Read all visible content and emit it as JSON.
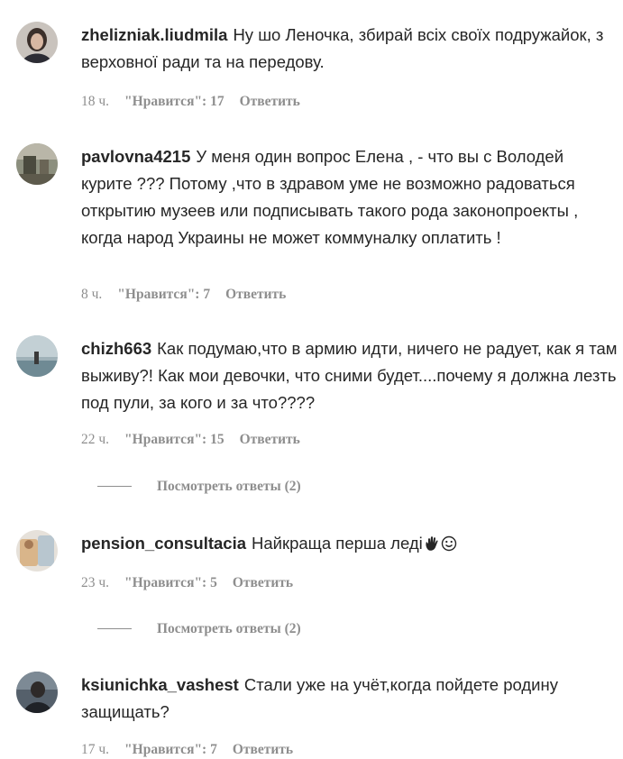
{
  "comments": [
    {
      "username": "zhelizniak.liudmila",
      "text": "Ну шо Леночка, збирай всіх своїх подружайок, з верховної ради та на передову.",
      "time": "18 ч.",
      "likes": "\"Нравится\": 17",
      "reply": "Ответить"
    },
    {
      "username": "pavlovna4215",
      "text": "У меня один вопрос Елена , - что вы с Володей курите ??? Потому ,что в здравом уме не возможно радоваться открытию музеев или подписывать такого рода законопроекты , когда народ Украины не может коммуналку оплатить !",
      "time": "8 ч.",
      "likes": "\"Нравится\": 7",
      "reply": "Ответить"
    },
    {
      "username": "chizh663",
      "text": "Как подумаю,что в армию идти, ничего не радует, как я там выживу?! Как мои девочки, что сними будет....почему я должна лезть под пули, за кого и за что????",
      "time": "22 ч.",
      "likes": "\"Нравится\": 15",
      "reply": "Ответить",
      "view_replies": "Посмотреть ответы (2)"
    },
    {
      "username": "pension_consultacia",
      "text": "Найкраща перша леді",
      "emoji": [
        "waving-hand-emoji",
        "smiling-face-emoji"
      ],
      "time": "23 ч.",
      "likes": "\"Нравится\": 5",
      "reply": "Ответить",
      "view_replies": "Посмотреть ответы (2)"
    },
    {
      "username": "ksiunichka_vashest",
      "text": "Стали уже на учёт,когда пойдете родину защищать?",
      "time": "17 ч.",
      "likes": "\"Нравится\": 7",
      "reply": "Ответить"
    }
  ]
}
